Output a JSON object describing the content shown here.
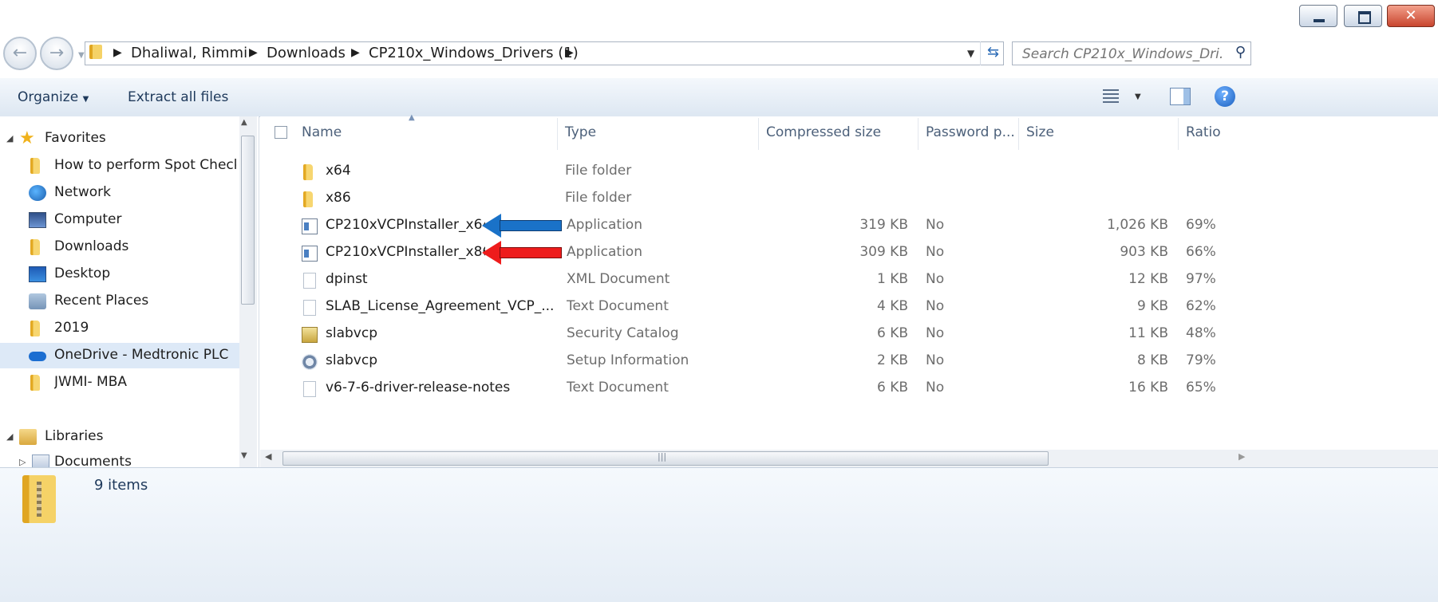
{
  "address": {
    "breadcrumbs": [
      "Dhaliwal, Rimmi",
      "Downloads",
      "CP210x_Windows_Drivers (1)"
    ],
    "search_placeholder": "Search CP210x_Windows_Dri..."
  },
  "toolbar": {
    "organize": "Organize",
    "extract": "Extract all files"
  },
  "nav": {
    "favorites": "Favorites",
    "items": [
      "How to perform Spot Check",
      "Network",
      "Computer",
      "Downloads",
      "Desktop",
      "Recent Places",
      "2019",
      "OneDrive - Medtronic PLC",
      "JWMI- MBA"
    ],
    "libraries": "Libraries",
    "documents": "Documents",
    "selected": "OneDrive - Medtronic PLC"
  },
  "columns": {
    "name": "Name",
    "type": "Type",
    "compressed": "Compressed size",
    "password": "Password p...",
    "size": "Size",
    "ratio": "Ratio"
  },
  "files": [
    {
      "name": "x64",
      "type": "File folder",
      "compressed": "",
      "password": "",
      "size": "",
      "ratio": "",
      "icon": "folder-icon"
    },
    {
      "name": "x86",
      "type": "File folder",
      "compressed": "",
      "password": "",
      "size": "",
      "ratio": "",
      "icon": "folder-icon"
    },
    {
      "name": "CP210xVCPInstaller_x64",
      "type": "Application",
      "compressed": "319 KB",
      "password": "No",
      "size": "1,026 KB",
      "ratio": "69%",
      "icon": "application-icon"
    },
    {
      "name": "CP210xVCPInstaller_x86",
      "type": "Application",
      "compressed": "309 KB",
      "password": "No",
      "size": "903 KB",
      "ratio": "66%",
      "icon": "application-icon"
    },
    {
      "name": "dpinst",
      "type": "XML Document",
      "compressed": "1 KB",
      "password": "No",
      "size": "12 KB",
      "ratio": "97%",
      "icon": "document-icon"
    },
    {
      "name": "SLAB_License_Agreement_VCP_...",
      "type": "Text Document",
      "compressed": "4 KB",
      "password": "No",
      "size": "9 KB",
      "ratio": "62%",
      "icon": "text-document-icon"
    },
    {
      "name": "slabvcp",
      "type": "Security Catalog",
      "compressed": "6 KB",
      "password": "No",
      "size": "11 KB",
      "ratio": "48%",
      "icon": "security-catalog-icon"
    },
    {
      "name": "slabvcp",
      "type": "Setup Information",
      "compressed": "2 KB",
      "password": "No",
      "size": "8 KB",
      "ratio": "79%",
      "icon": "setup-information-icon"
    },
    {
      "name": "v6-7-6-driver-release-notes",
      "type": "Text Document",
      "compressed": "6 KB",
      "password": "No",
      "size": "16 KB",
      "ratio": "65%",
      "icon": "text-document-icon"
    }
  ],
  "annotations": {
    "blue_arrow_color": "#1a72c8",
    "red_arrow_color": "#ee1c1c"
  },
  "status": {
    "item_count": "9 items"
  }
}
